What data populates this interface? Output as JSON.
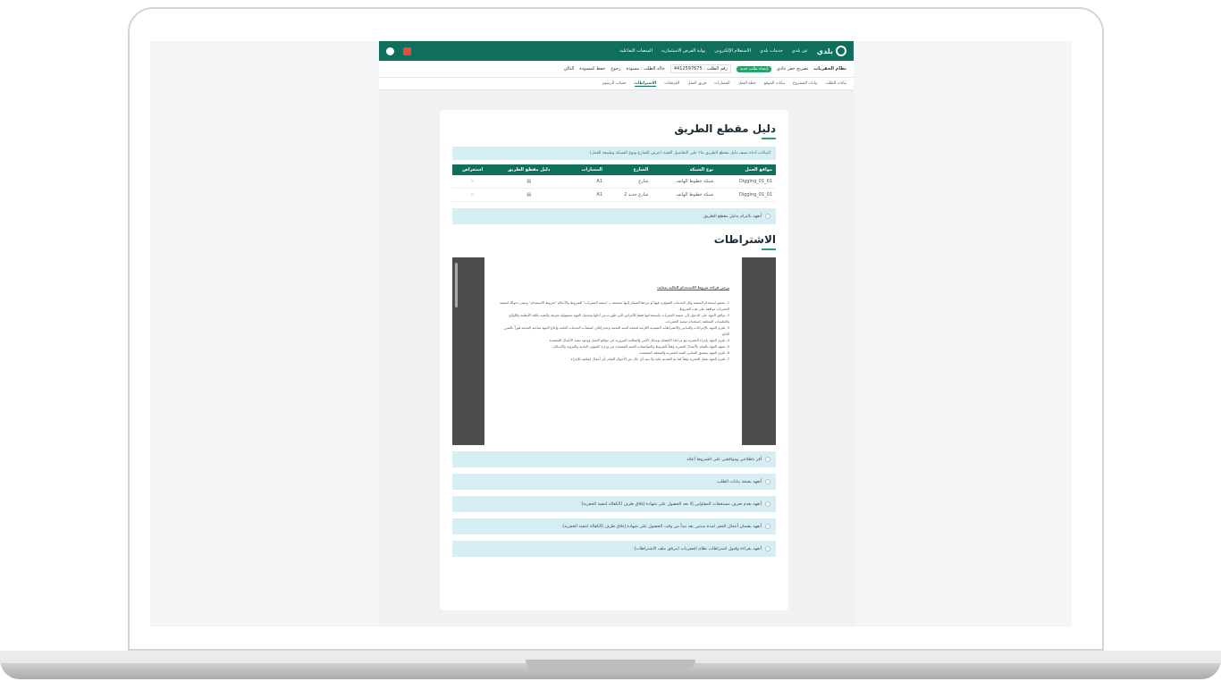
{
  "topnav": {
    "logo_text": "بلدي",
    "items": [
      "عن بلدي",
      "خدمات بلدي",
      "الاستعلام الإلكتروني",
      "بوابة الفرص الاستثمارية",
      "المنصات التفاعلية"
    ]
  },
  "subbar": {
    "system_title": "نظام الحفريات",
    "breadcrumb": "تصريح حفر عادي",
    "pill": "إنشاء طلب جديد",
    "request_number": "رقم الطلب : 4412597675",
    "request_status": "حالة الطلب : مسودة",
    "back": "رجوع",
    "save_draft": "حفظ كمسودة",
    "next": "التالي"
  },
  "steps": [
    "بيانات الطلب",
    "بيانات المشروع",
    "بيانات الموقع",
    "خطة العمل",
    "المسارات",
    "فريق العمل",
    "المرفقات",
    "الاشتراطات",
    "حساب الرسوم"
  ],
  "guide": {
    "title": "دليل مقطع الطريق",
    "info": "البيانات أدناه تصف دليل مقطع الطريق بناء على التفاصيل الفنية (عرض الشارع ونوع الشبكة وطبيعة العمل)",
    "columns": [
      "مواقع العمل",
      "نوع الشبكة",
      "الشارع",
      "المسارات",
      "دليل مقطع الطريق",
      "استعراض"
    ],
    "rows": [
      [
        "Digging_01_01",
        "شبكة خطوط الهاتف",
        "شارع",
        "A1"
      ],
      [
        "Digging_01_01",
        "شبكة خطوط الهاتف",
        "شارع جديد 2",
        "A1"
      ]
    ],
    "commit": "أتعهد بالتزام بدليل مقطع الطريق"
  },
  "conditions": {
    "title": "الاشتراطات",
    "doc_heading": "يرجى قراءة شروط الاستخدام التالية بعناية:",
    "doc_lines": [
      "1. يخضع استخدام المنصة وكل الخدمات المتوفرة فيها أو جزءها المشار إليها مجتمعة بـ \"منصة الحفريات\" للشروط والأحكام \"شروط الاستخدام\" ويعتبر دخولك لمنصة الحفريات موافقة على هذه الشروط.",
      "2. توافق الجهة على الدخول إلى منصة الحفريات واستخدامها فقط للأغراض التي طورت من أجلها وتتحمل الجهة مسؤولية معرفة والتقيد بكافة الأنظمة واللوائح والتعليمات المتعلقة باستخدام منصة الحفريات.",
      "3. تلتزم الجهة بالإجراءات والتدابير والاشتراطات التنفيذية اللازمة لحماية البنية التحتية وعدم إتلاف لمنشآت الخدمات العامة وإبلاغ الجهة صاحبة الخدمة فوراً بالضرر الناتج.",
      "4. تلتزم الجهة بإجراء الحفرية مع مراعاة الاهتمام بوسائل الأمن والسلامة المرورية في مواقع العمل ووجود تنفيذ الأعمال المعتمدة.",
      "5. تتعهد الجهة بالقيام بالأعمال الحفرية وفقاً للشروط والمواصفات الفنية المعتمدة من وزارة الشؤون البلدية والقروية والإسكان.",
      "6. تلتزم الجهة بتحقيق المعايير الفنية للحفرية والسفلتة المعتمدة.",
      "7. تلتزم الجهة بعمل الحفرية وفقاً لما تم التقديم عليه ولا يتم بأي حال من الأحوال القيام بأي أعمال إضافية للإجراء."
    ],
    "checks": [
      "أقر باطلاعي وموافقتي على الشروط أعلاه",
      "أتعهد بصحة بيانات الطلب",
      "أتعهد بعدم صرف مستحقات المقاولين إلا بعد الحصول على شهادة إغلاق طرف (الكفالة لتنفيذ الحفرية)",
      "أتعهد بضمان أعمال الحفر لمدة سنتين بعد تبدأ من وقت الحصول على شهادة إغلاق طرف (الكفالة لتنفيذ الحفرية)",
      "أتعهد بقراءة وقبول اشتراطات نظام الحفريات (مرفق ملف الاشتراطات)"
    ]
  }
}
